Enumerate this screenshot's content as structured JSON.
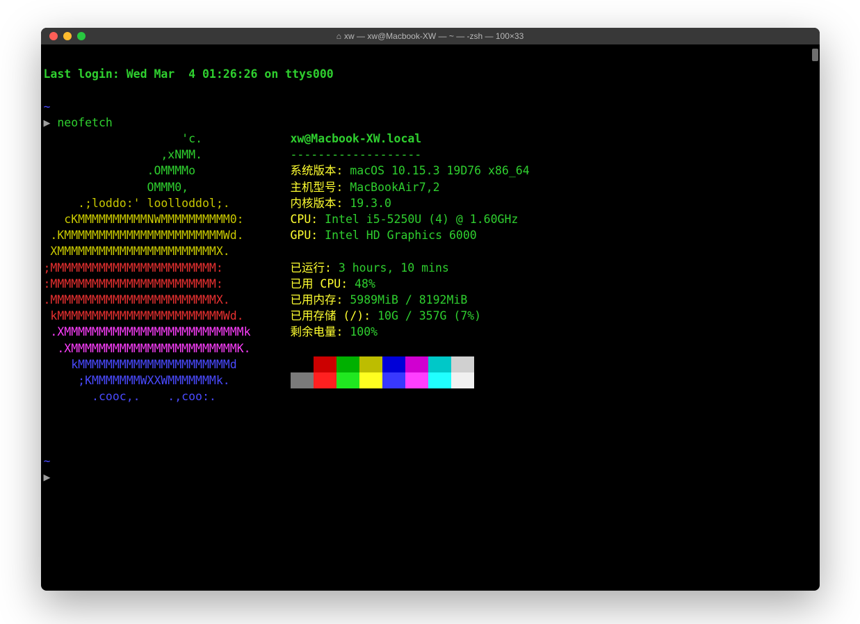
{
  "window": {
    "title": "xw — xw@Macbook-XW — ~ — -zsh — 100×33"
  },
  "lastLogin": "Last login: Wed Mar  4 01:26:26 on ttys000",
  "tilde": "~",
  "promptGlyph": "▶",
  "command": "neofetch",
  "logo": {
    "l1": "                    'c.          ",
    "l2": "                 ,xNMM.          ",
    "l3": "               .OMMMMo           ",
    "l4": "               OMMM0,            ",
    "l5": "     .;loddo:' loolloddol;.      ",
    "l6": "   cKMMMMMMMMMMNWMMMMMMMMMM0:    ",
    "l7": " .KMMMMMMMMMMMMMMMMMMMMMMMWd.    ",
    "l8": " XMMMMMMMMMMMMMMMMMMMMMMMX.      ",
    "l9": ";MMMMMMMMMMMMMMMMMMMMMMMM:       ",
    "l10": ":MMMMMMMMMMMMMMMMMMMMMMMM:       ",
    "l11": ".MMMMMMMMMMMMMMMMMMMMMMMMX.      ",
    "l12": " kMMMMMMMMMMMMMMMMMMMMMMMMWd.    ",
    "l13": " .XMMMMMMMMMMMMMMMMMMMMMMMMMMk   ",
    "l14": "  .XMMMMMMMMMMMMMMMMMMMMMMMMK.   ",
    "l15": "    kMMMMMMMMMMMMMMMMMMMMMMd     ",
    "l16": "     ;KMMMMMMMWXXWMMMMMMMk.      ",
    "l17": "       .cooc,.    .,coo:.        "
  },
  "info": {
    "userhost": "xw@Macbook-XW.local",
    "sep": "-------------------",
    "osLabel": "系统版本: ",
    "osValue": "macOS 10.15.3 19D76 x86_64",
    "hostLabel": "主机型号: ",
    "hostValue": "MacBookAir7,2",
    "kernLabel": "内核版本: ",
    "kernValue": "19.3.0",
    "cpuLabel": "CPU: ",
    "cpuValue": "Intel i5-5250U (4) @ 1.60GHz",
    "gpuLabel": "GPU: ",
    "gpuValue": "Intel HD Graphics 6000",
    "upLabel": "已运行: ",
    "upValue": "3 hours, 10 mins",
    "cpuUseLabel": "已用 CPU: ",
    "cpuUseValue": "48%",
    "memLabel": "已用内存: ",
    "memValue": "5989MiB / 8192MiB",
    "diskLabel": "已用存储 (/): ",
    "diskValue": "10G / 357G (7%)",
    "batLabel": "剩余电量: ",
    "batValue": "100%"
  },
  "swatches": {
    "row1": [
      "transparent",
      "#cc0000",
      "#00b000",
      "#bdbd00",
      "#0000d8",
      "#d000d0",
      "#00c8c8",
      "#d0d0d0"
    ],
    "row2": [
      "#7a7a7a",
      "#ff2020",
      "#20e820",
      "#ffff20",
      "#3838ff",
      "#ff3fff",
      "#20ffff",
      "#f0f0f0"
    ]
  }
}
